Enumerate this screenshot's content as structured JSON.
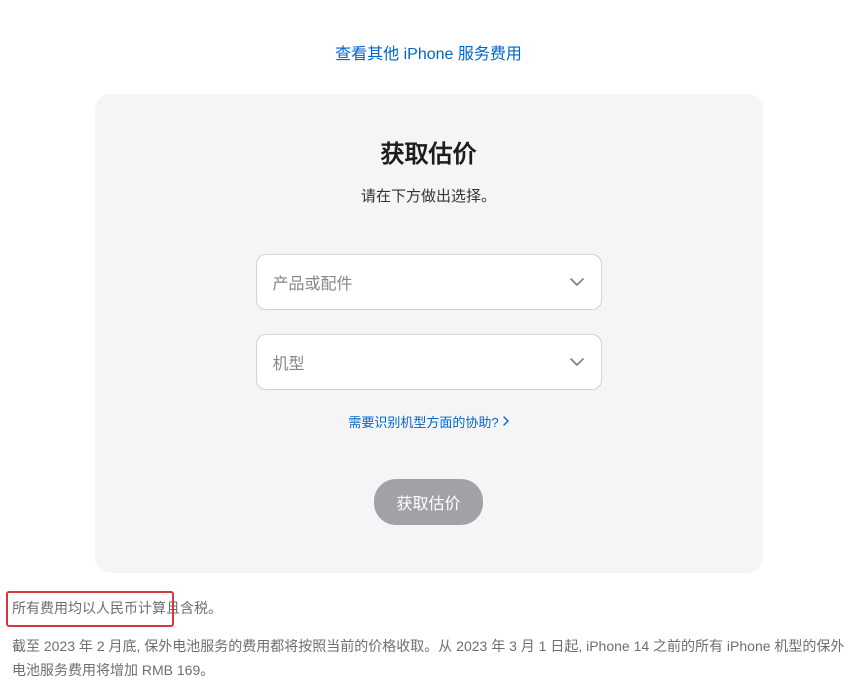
{
  "topLink": {
    "label": "查看其他 iPhone 服务费用"
  },
  "card": {
    "title": "获取估价",
    "subtitle": "请在下方做出选择。",
    "select1": {
      "placeholder": "产品或配件"
    },
    "select2": {
      "placeholder": "机型"
    },
    "helpLink": {
      "label": "需要识别机型方面的协助?"
    },
    "submitButton": {
      "label": "获取估价"
    }
  },
  "footer": {
    "para1": "所有费用均以人民币计算且含税。",
    "para2": "截至 2023 年 2 月底, 保外电池服务的费用都将按照当前的价格收取。从 2023 年 3 月 1 日起, iPhone 14 之前的所有 iPhone 机型的保外电池服务费用将增加 RMB 169。"
  }
}
